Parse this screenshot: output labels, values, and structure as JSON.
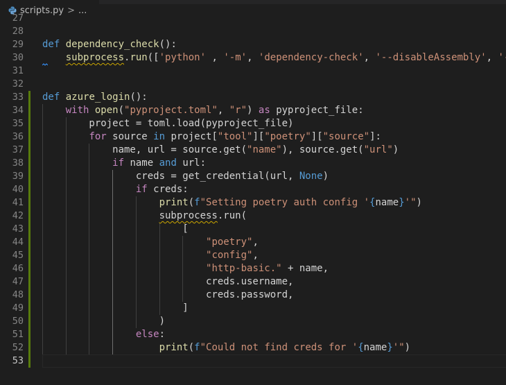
{
  "breadcrumb": {
    "file_name": "scripts.py",
    "separator": ">",
    "more": "..."
  },
  "editor": {
    "active_line": 53,
    "lines": [
      {
        "n": 27,
        "tokens": []
      },
      {
        "n": 28,
        "tokens": []
      },
      {
        "n": 29,
        "tokens": [
          [
            "kw",
            "def"
          ],
          [
            "pn",
            " "
          ],
          [
            "fn",
            "dependency_check"
          ],
          [
            "pn",
            "():"
          ]
        ]
      },
      {
        "n": 30,
        "tokens": [
          [
            "pn",
            "    "
          ],
          [
            "fn squig",
            "subprocess"
          ],
          [
            "pn",
            "."
          ],
          [
            "fn",
            "run"
          ],
          [
            "pn",
            "(["
          ],
          [
            "str",
            "'python'"
          ],
          [
            "pn",
            " , "
          ],
          [
            "str",
            "'-m'"
          ],
          [
            "pn",
            ", "
          ],
          [
            "str",
            "'dependency-check'"
          ],
          [
            "pn",
            ", "
          ],
          [
            "str",
            "'--disableAssembly'"
          ],
          [
            "pn",
            ", "
          ],
          [
            "str",
            "'-"
          ]
        ]
      },
      {
        "n": 31,
        "tokens": []
      },
      {
        "n": 32,
        "tokens": []
      },
      {
        "n": 33,
        "tokens": [
          [
            "kw",
            "def"
          ],
          [
            "pn",
            " "
          ],
          [
            "fn",
            "azure_login"
          ],
          [
            "pn",
            "():"
          ]
        ]
      },
      {
        "n": 34,
        "tokens": [
          [
            "pn",
            "    "
          ],
          [
            "ctrl",
            "with"
          ],
          [
            "pn",
            " "
          ],
          [
            "fn",
            "open"
          ],
          [
            "pn",
            "("
          ],
          [
            "str",
            "\"pyproject.toml\""
          ],
          [
            "pn",
            ", "
          ],
          [
            "str",
            "\"r\""
          ],
          [
            "pn",
            ") "
          ],
          [
            "ctrl",
            "as"
          ],
          [
            "pn",
            " pyproject_file:"
          ]
        ]
      },
      {
        "n": 35,
        "tokens": [
          [
            "pn",
            "        project = toml.load(pyproject_file)"
          ]
        ]
      },
      {
        "n": 36,
        "tokens": [
          [
            "pn",
            "        "
          ],
          [
            "ctrl",
            "for"
          ],
          [
            "pn",
            " source "
          ],
          [
            "kw",
            "in"
          ],
          [
            "pn",
            " project["
          ],
          [
            "str",
            "\"tool\""
          ],
          [
            "pn",
            "]["
          ],
          [
            "str",
            "\"poetry\""
          ],
          [
            "pn",
            "]["
          ],
          [
            "str",
            "\"source\""
          ],
          [
            "pn",
            "]:"
          ]
        ]
      },
      {
        "n": 37,
        "tokens": [
          [
            "pn",
            "            name, url = source.get("
          ],
          [
            "str",
            "\"name\""
          ],
          [
            "pn",
            "), source.get("
          ],
          [
            "str",
            "\"url\""
          ],
          [
            "pn",
            ")"
          ]
        ]
      },
      {
        "n": 38,
        "tokens": [
          [
            "pn",
            "            "
          ],
          [
            "ctrl",
            "if"
          ],
          [
            "pn",
            " name "
          ],
          [
            "kw",
            "and"
          ],
          [
            "pn",
            " url:"
          ]
        ]
      },
      {
        "n": 39,
        "tokens": [
          [
            "pn",
            "                creds = get_credential(url, "
          ],
          [
            "kw",
            "None"
          ],
          [
            "pn",
            ")"
          ]
        ]
      },
      {
        "n": 40,
        "tokens": [
          [
            "pn",
            "                "
          ],
          [
            "ctrl",
            "if"
          ],
          [
            "pn",
            " creds:"
          ]
        ]
      },
      {
        "n": 41,
        "tokens": [
          [
            "pn",
            "                    "
          ],
          [
            "fn",
            "print"
          ],
          [
            "pn",
            "("
          ],
          [
            "kw",
            "f"
          ],
          [
            "str",
            "\"Setting poetry auth config '"
          ],
          [
            "kw",
            "{"
          ],
          [
            "pn",
            "name"
          ],
          [
            "kw",
            "}"
          ],
          [
            "str",
            "'\""
          ],
          [
            "pn",
            ")"
          ]
        ]
      },
      {
        "n": 42,
        "tokens": [
          [
            "pn",
            "                    "
          ],
          [
            "pn squig",
            "subprocess"
          ],
          [
            "pn",
            ".run("
          ]
        ]
      },
      {
        "n": 43,
        "tokens": [
          [
            "pn",
            "                        ["
          ]
        ]
      },
      {
        "n": 44,
        "tokens": [
          [
            "pn",
            "                            "
          ],
          [
            "str",
            "\"poetry\""
          ],
          [
            "pn",
            ","
          ]
        ]
      },
      {
        "n": 45,
        "tokens": [
          [
            "pn",
            "                            "
          ],
          [
            "str",
            "\"config\""
          ],
          [
            "pn",
            ","
          ]
        ]
      },
      {
        "n": 46,
        "tokens": [
          [
            "pn",
            "                            "
          ],
          [
            "str",
            "\"http-basic.\""
          ],
          [
            "pn",
            " + name,"
          ]
        ]
      },
      {
        "n": 47,
        "tokens": [
          [
            "pn",
            "                            creds.username,"
          ]
        ]
      },
      {
        "n": 48,
        "tokens": [
          [
            "pn",
            "                            creds.password,"
          ]
        ]
      },
      {
        "n": 49,
        "tokens": [
          [
            "pn",
            "                        ]"
          ]
        ]
      },
      {
        "n": 50,
        "tokens": [
          [
            "pn",
            "                    )"
          ]
        ]
      },
      {
        "n": 51,
        "tokens": [
          [
            "pn",
            "                "
          ],
          [
            "ctrl",
            "else"
          ],
          [
            "pn",
            ":"
          ]
        ]
      },
      {
        "n": 52,
        "tokens": [
          [
            "pn",
            "                    "
          ],
          [
            "fn",
            "print"
          ],
          [
            "pn",
            "("
          ],
          [
            "kw",
            "f"
          ],
          [
            "str",
            "\"Could not find creds for '"
          ],
          [
            "kw",
            "{"
          ],
          [
            "pn",
            "name"
          ],
          [
            "kw",
            "}"
          ],
          [
            "str",
            "'\""
          ],
          [
            "pn",
            ")"
          ]
        ]
      },
      {
        "n": 53,
        "tokens": []
      }
    ]
  },
  "colors": {
    "background": "#1e1e1e",
    "keyword": "#569cd6",
    "control": "#c586c0",
    "function": "#dcdcaa",
    "string": "#ce9178",
    "git_modified": "#587c0c"
  }
}
